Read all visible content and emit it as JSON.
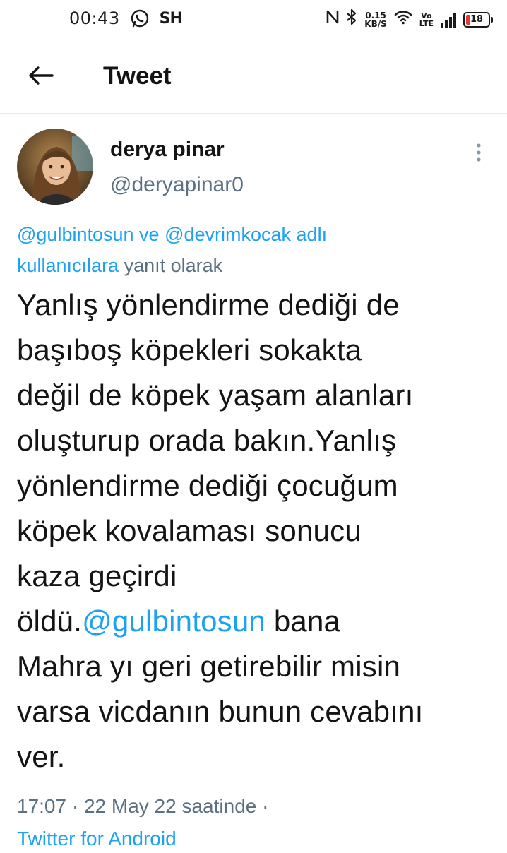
{
  "status_bar": {
    "time": "00:43",
    "sh_label": "SH",
    "net_speed_value": "0.15",
    "net_speed_unit": "KB/S",
    "volte_top": "Vo",
    "volte_bottom": "LTE",
    "battery": "18",
    "icons": [
      "whatsapp-icon",
      "nfc-icon",
      "bluetooth-icon",
      "wifi-icon",
      "signal-icon",
      "battery-icon"
    ]
  },
  "header": {
    "title": "Tweet",
    "back_icon": "back-arrow-icon"
  },
  "tweet": {
    "author_name": "derya pinar",
    "author_handle": "@deryapinar0",
    "reply_context": {
      "mention_1": "@gulbintosun",
      "connector": " ve ",
      "mention_2": "@devrimkocak",
      "mention_2_suffix": " adlı",
      "mention_2_line2": "kullanıcılara",
      "suffix": " yanıt olarak"
    },
    "body_lines": [
      "Yanlış yönlendirme dediği de",
      "başıboş köpekleri sokakta",
      "değil de köpek yaşam alanları",
      "oluşturup orada bakın.Yanlış",
      "yönlendirme dediği çocuğum",
      "köpek kovalaması sonucu",
      "kaza geçirdi"
    ],
    "body_mention_prefix": "öldü.",
    "body_mention": "@gulbintosun",
    "body_mention_suffix": " bana",
    "body_lines_after": [
      "Mahra yı geri getirebilir misin",
      "varsa vicdanın bunun cevabını",
      "ver."
    ],
    "timestamp": "17:07 · 22 May 22 saatinde ·",
    "source": "Twitter for Android"
  },
  "colors": {
    "link": "#1da1f2",
    "secondary_text": "#5b7083",
    "primary_text": "#141414",
    "battery_low": "#e23a3a"
  }
}
